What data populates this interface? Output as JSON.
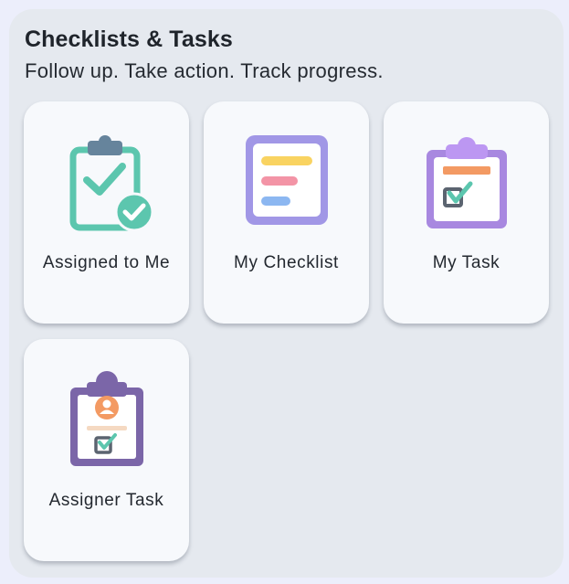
{
  "header": {
    "title": "Checklists & Tasks",
    "subtitle": "Follow up. Take action. Track progress."
  },
  "cards": [
    {
      "label": "Assigned to Me",
      "icon": "clipboard-check-badge-icon",
      "accent": "#5CC6AE"
    },
    {
      "label": "My Checklist",
      "icon": "checklist-document-icon",
      "accent": "#A197E6"
    },
    {
      "label": "My Task",
      "icon": "clipboard-task-icon",
      "accent": "#A888E0"
    },
    {
      "label": "Assigner Task",
      "icon": "clipboard-person-icon",
      "accent": "#7B66A8"
    }
  ],
  "colors": {
    "page_background": "#ECEEFB",
    "panel_background": "#E5E9EF",
    "card_background": "#F7F9FC",
    "text": "#23282F"
  }
}
